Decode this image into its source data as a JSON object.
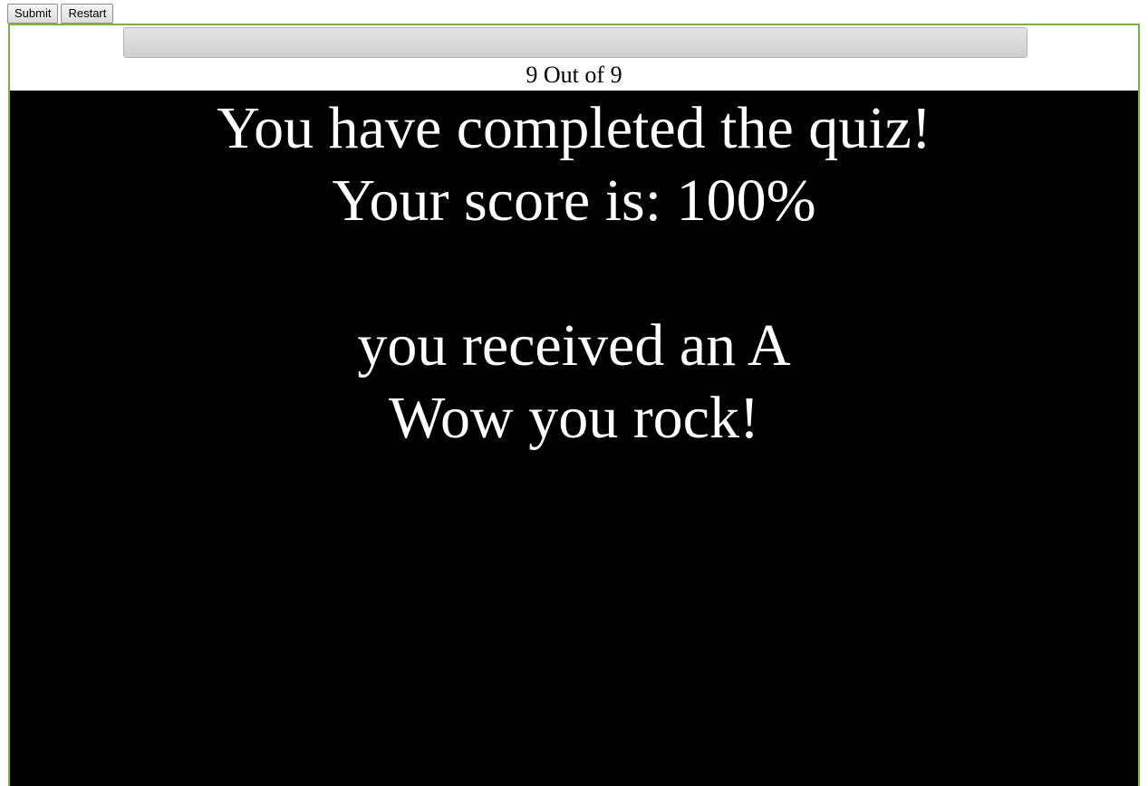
{
  "toolbar": {
    "submit_label": "Submit",
    "restart_label": "Restart"
  },
  "progress": {
    "current": 9,
    "total": 9,
    "fraction": 1.0,
    "text": "9 Out of 9"
  },
  "result": {
    "completed_text": "You have completed the quiz!",
    "score_text": "Your score is: 100%",
    "grade_text": "you received an A",
    "message_text": "Wow you rock!"
  },
  "colors": {
    "frame_border": "#7ab342",
    "panel_background": "#000000",
    "panel_text": "#ffffff"
  }
}
